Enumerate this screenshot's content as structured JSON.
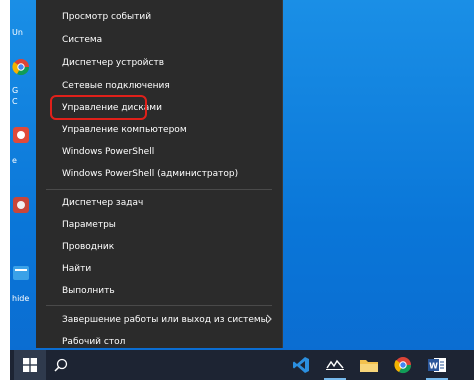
{
  "menu": {
    "items": [
      {
        "label": "Просмотр событий"
      },
      {
        "label": "Система"
      },
      {
        "label": "Диспетчер устройств"
      },
      {
        "label": "Сетевые подключения"
      },
      {
        "label": "Управление дисками"
      },
      {
        "label": "Управление компьютером"
      },
      {
        "label": "Windows PowerShell"
      },
      {
        "label": "Windows PowerShell (администратор)"
      },
      {
        "label": "Диспетчер задач"
      },
      {
        "label": "Параметры"
      },
      {
        "label": "Проводник"
      },
      {
        "label": "Найти"
      },
      {
        "label": "Выполнить"
      },
      {
        "label": "Завершение работы или выход из системы"
      },
      {
        "label": "Рабочий стол"
      }
    ],
    "highlighted": "Управление дисками"
  },
  "desktop": {
    "partial_labels": [
      "Un",
      "G",
      "C",
      "e",
      "hide"
    ]
  },
  "taskbar": {
    "icons": [
      "windows-start-icon",
      "search-icon",
      "vscode-icon",
      "app-icon",
      "folder-icon",
      "chrome-icon",
      "word-icon"
    ]
  },
  "colors": {
    "menu_bg": "#2b2b2b",
    "highlight_border": "#e0201a",
    "desktop_blue": "#0a76d8",
    "taskbar_bg": "#1d2433"
  }
}
